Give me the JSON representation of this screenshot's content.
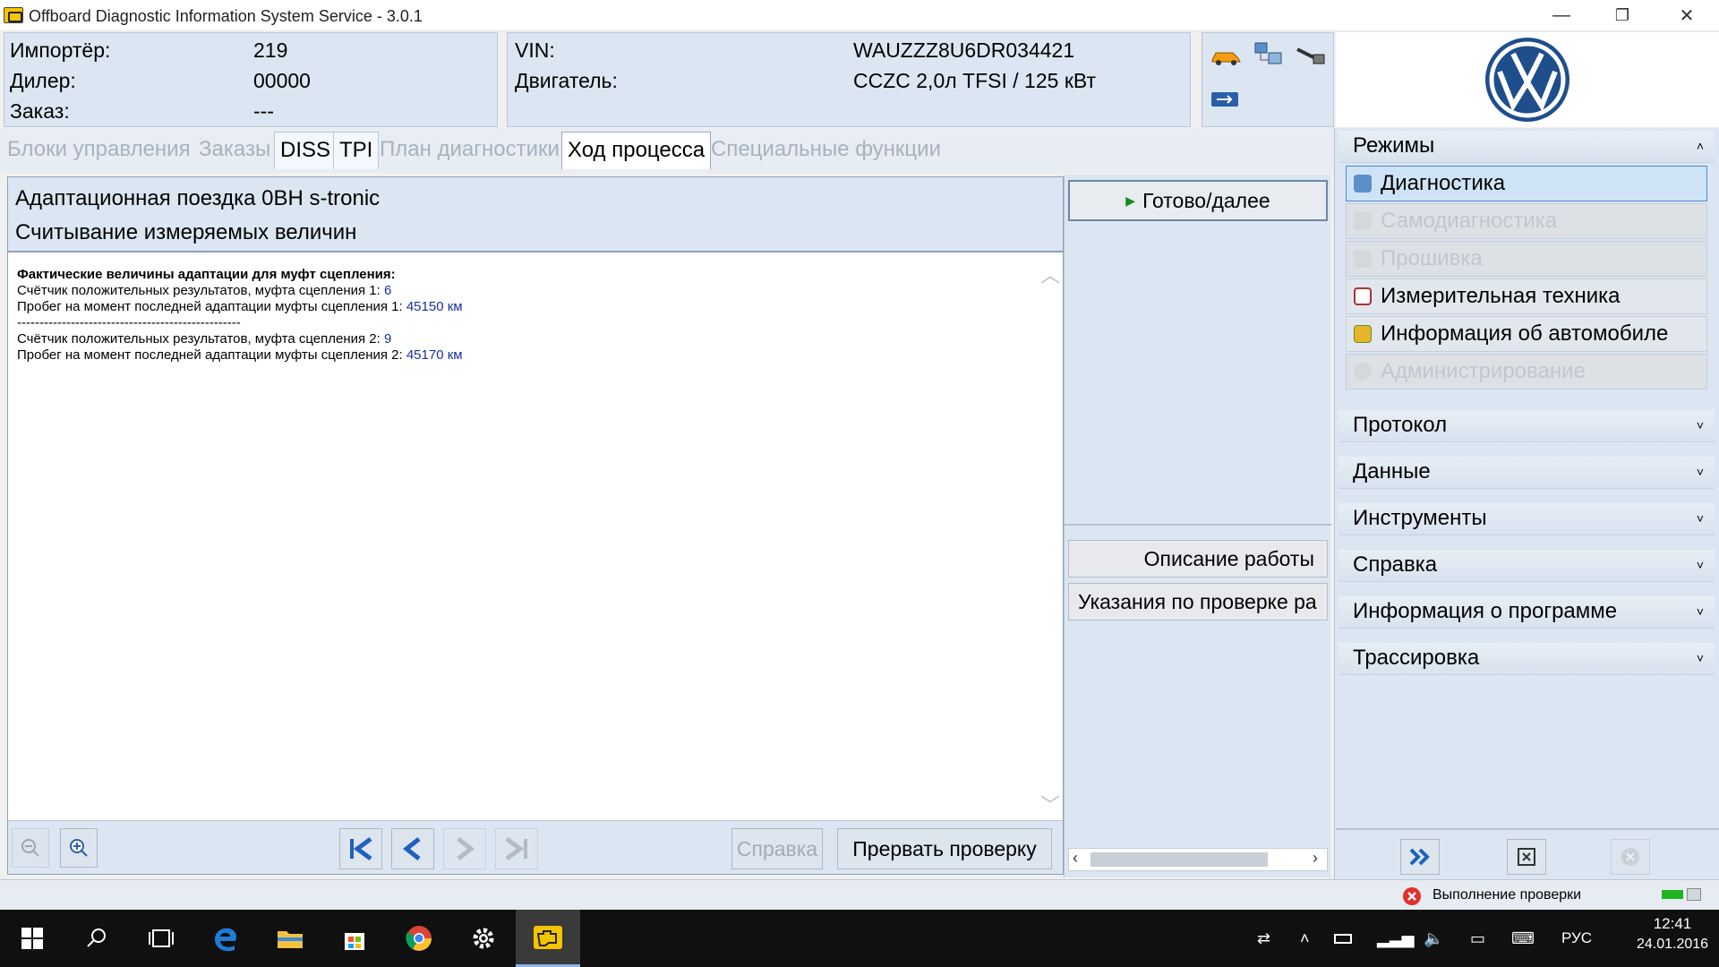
{
  "window": {
    "title": "Offboard Diagnostic Information System Service - 3.0.1",
    "minimize": "—",
    "restore": "❐",
    "close": "✕"
  },
  "header": {
    "importer_label": "Импортёр:",
    "importer_value": "219",
    "dealer_label": "Дилер:",
    "dealer_value": "00000",
    "order_label": "Заказ:",
    "order_value": "---",
    "vin_label": "VIN:",
    "vin_value": "WAUZZZ8U6DR034421",
    "engine_label": "Двигатель:",
    "engine_value": "CCZC 2,0л TFSI / 125 кВт"
  },
  "tabs": [
    {
      "label": "Блоки управления"
    },
    {
      "label": "Заказы"
    },
    {
      "label": "DISS"
    },
    {
      "label": "TPI"
    },
    {
      "label": "План диагностики"
    },
    {
      "label": "Ход процесса"
    },
    {
      "label": "Специальные функции"
    }
  ],
  "content": {
    "title1": "Адаптационная поездка 0BH s-tronic",
    "title2": "Считывание измеряемых величин",
    "heading": "Фактические величины адаптации для муфт сцепления:",
    "line1_label": "Счётчик положительных результатов, муфта сцепления 1: ",
    "line1_value": "6",
    "line2_label": "Пробег на момент последней адаптации муфты сцепления 1: ",
    "line2_value": "45150 км",
    "separator": "--------------------------------------------------",
    "line3_label": "Счётчик положительных результатов, муфта сцепления 2: ",
    "line3_value": "9",
    "line4_label": "Пробег на момент последней адаптации муфты сцепления 2: ",
    "line4_value": "45170 км"
  },
  "actions": {
    "next": "Готово/далее",
    "description": "Описание работы",
    "test_instructions": "Указания по проверке ра",
    "help": "Справка",
    "abort": "Прервать проверку"
  },
  "modes": {
    "header": "Режимы",
    "items": [
      {
        "label": "Диагностика"
      },
      {
        "label": "Самодиагностика"
      },
      {
        "label": "Прошивка"
      },
      {
        "label": "Измерительная техника"
      },
      {
        "label": "Информация об автомобиле"
      },
      {
        "label": "Администрирование"
      }
    ]
  },
  "sections": [
    {
      "label": "Протокол"
    },
    {
      "label": "Данные"
    },
    {
      "label": "Инструменты"
    },
    {
      "label": "Справка"
    },
    {
      "label": "Информация о программе"
    },
    {
      "label": "Трассировка"
    }
  ],
  "status": {
    "text": "Выполнение проверки"
  },
  "taskbar": {
    "language": "РУС",
    "time": "12:41",
    "date": "24.01.2016"
  }
}
